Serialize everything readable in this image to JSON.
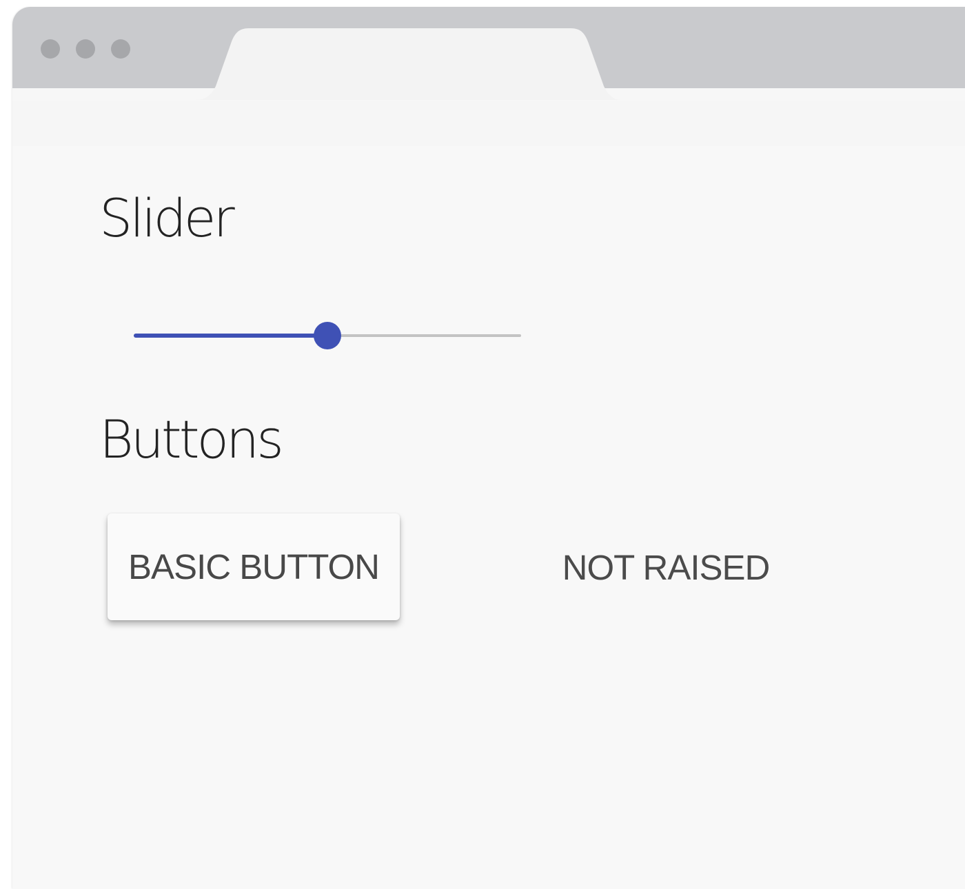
{
  "window": {
    "controls": [
      {
        "name": "window-dot-1"
      },
      {
        "name": "window-dot-2"
      },
      {
        "name": "window-dot-3"
      }
    ],
    "tab": {
      "label": ""
    }
  },
  "sections": {
    "slider": {
      "title": "Slider",
      "value": 0.5,
      "accent_color": "#3f51b5",
      "track_color": "#c3c3c3"
    },
    "buttons": {
      "title": "Buttons",
      "basic_button_label": "BASIC BUTTON",
      "not_raised_button_label": "NOT RAISED"
    }
  },
  "colors": {
    "titlebar": "#c9cacd",
    "window_controls": "#a6a7aa",
    "page_background": "#f8f8f8",
    "tab": "#f3f3f3"
  }
}
